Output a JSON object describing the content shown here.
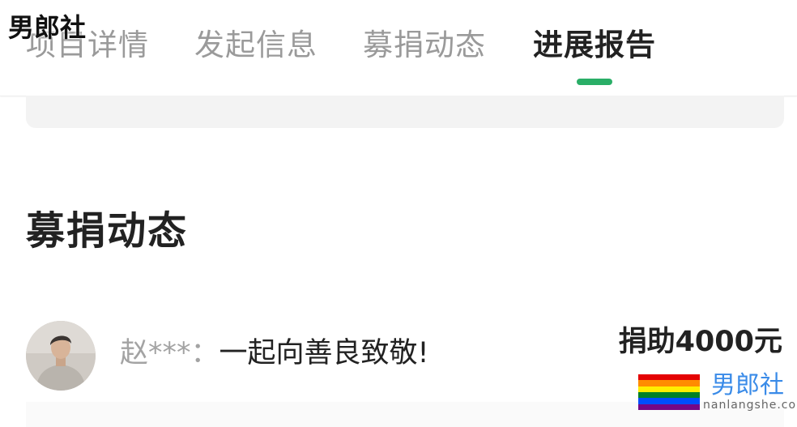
{
  "watermark_top": "男郎社",
  "tabs": [
    {
      "label": "项目详情",
      "active": false
    },
    {
      "label": "发起信息",
      "active": false
    },
    {
      "label": "募捐动态",
      "active": false
    },
    {
      "label": "进展报告",
      "active": true
    }
  ],
  "accent_color": "#2aae67",
  "section": {
    "title": "募捐动态"
  },
  "donations": [
    {
      "donor": "赵***：",
      "message": "一起向善良致敬!",
      "amount": "捐助4000元"
    }
  ],
  "watermark_bottom": {
    "name": "男郎社",
    "url": "nanlangshe.com",
    "flag_colors": [
      "#e40303",
      "#ff8c00",
      "#ffed00",
      "#008026",
      "#004dff",
      "#750787"
    ]
  }
}
